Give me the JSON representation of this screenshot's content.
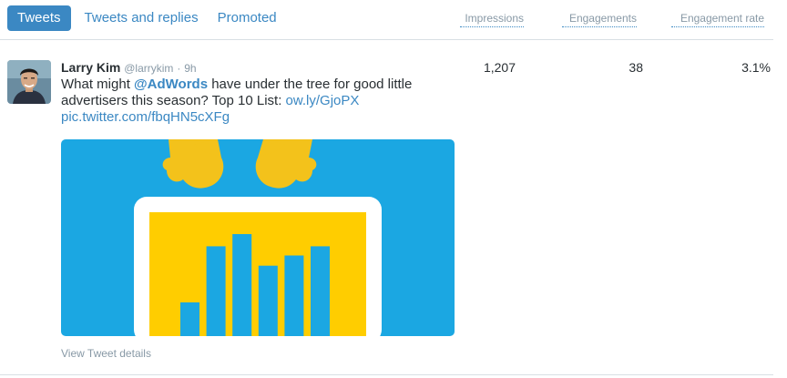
{
  "tabs": [
    {
      "label": "Tweets",
      "active": true
    },
    {
      "label": "Tweets and replies",
      "active": false
    },
    {
      "label": "Promoted",
      "active": false
    }
  ],
  "columns": {
    "impressions": "Impressions",
    "engagements": "Engagements",
    "engagement_rate": "Engagement rate"
  },
  "tweet": {
    "author_name": "Larry Kim",
    "handle": "@larrykim",
    "separator": "·",
    "time": "9h",
    "text_before": "What might ",
    "mention": "@AdWords",
    "text_after": " have under the tree for good little advertisers this season? Top 10 List: ",
    "link": "ow.ly/GjoPX",
    "pic_link": "pic.twitter.com/fbqHN5cXFg",
    "impressions": "1,207",
    "engagements": "38",
    "engagement_rate": "3.1%",
    "details_label": "View Tweet details"
  },
  "media": {
    "background_color": "#1ba7e2",
    "screen_color": "#ffffff",
    "panel_color": "#ffcd00",
    "bar_color": "#1ba7e2",
    "hands_color": "#f3c21b",
    "bar_levels": [
      0.33,
      0.88,
      1.0,
      0.69,
      0.79,
      0.88
    ]
  },
  "colors": {
    "accent": "#3b88c3",
    "muted": "#8899a6",
    "text": "#292f33"
  }
}
